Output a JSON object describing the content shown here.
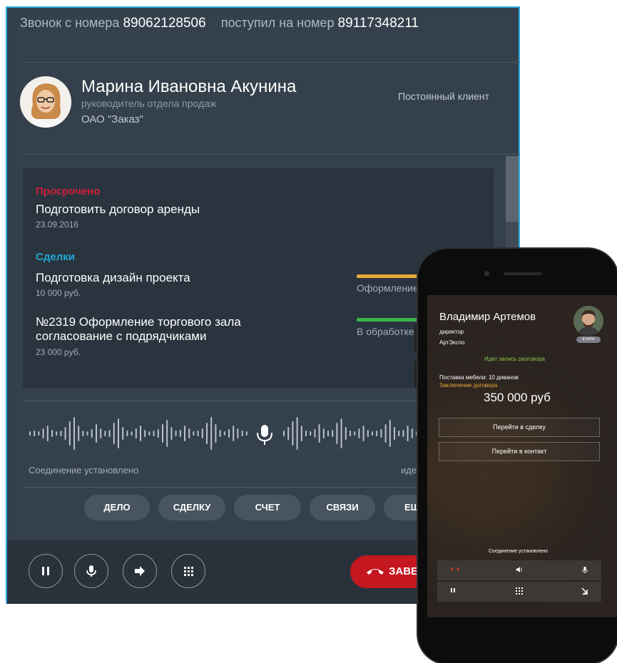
{
  "header": {
    "from_prefix": "Звонок с номера",
    "from_number": "89062128506",
    "to_prefix": "поступил на номер",
    "to_number": "89117348211"
  },
  "contact": {
    "name": "Марина Ивановна Акунина",
    "position": "руководитель отдела продаж",
    "company": "ОАО \"Заказ\"",
    "status": "Постоянный клиент"
  },
  "overdue": {
    "heading": "Просрочено",
    "task_title": "Подготовить договор аренды",
    "task_date": "23.09.2016"
  },
  "deals": {
    "heading": "Сделки",
    "items": [
      {
        "title": "Подготовка дизайн проекта",
        "amount": "10 000 руб.",
        "stage": "Оформление",
        "stage_color": "#e8a93a"
      },
      {
        "title": "№2319 Оформление торгового зала согласование с подрядчиками",
        "title_line1": "№2319 Оформление торгового зала",
        "title_line2": "согласование с подрядчиками",
        "amount": "23 000 руб.",
        "stage": "В обработке",
        "stage_color": "#3cb54a"
      }
    ]
  },
  "call": {
    "connection_status": "Соединение установлено",
    "recording_status_partial": "иде"
  },
  "actions": [
    "ДЕЛО",
    "СДЕЛКУ",
    "СЧЕТ",
    "СВЯЗИ",
    "ЕЩ"
  ],
  "controls": {
    "pause_icon": "pause-icon",
    "mic_icon": "microphone-icon",
    "transfer_icon": "arrow-right-icon",
    "keypad_icon": "keypad-icon",
    "end_label": "ЗАВЕ"
  },
  "phone": {
    "name": "Владимир Артемов",
    "position": "директор",
    "company": "АртЭкспо",
    "badge": "в сети",
    "recording": "Идет запись разговора",
    "deal": "Поставка мебели: 10 диванов",
    "deal_stage": "Заключение договора",
    "amount": "350 000 руб",
    "goto_deal": "Перейти в сделку",
    "goto_contact": "Перейти в контакт",
    "connection": "Соединение установлено"
  },
  "colors": {
    "window_bg": "#34404c",
    "window_border": "#2fa8e0",
    "overdue": "#d01f3c",
    "deals": "#1ea7d6",
    "end_call": "#c41720"
  }
}
